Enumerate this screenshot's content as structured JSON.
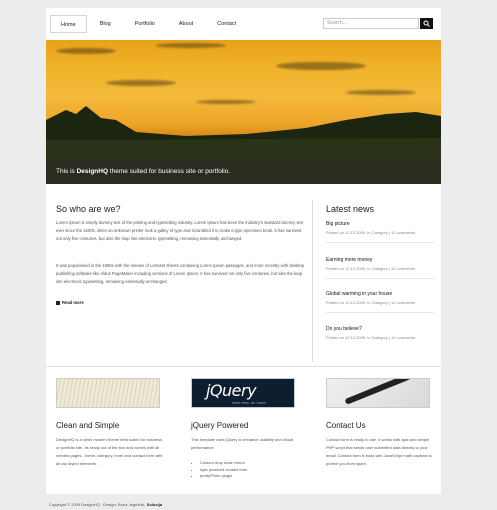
{
  "nav": {
    "items": [
      "Home",
      "Blog",
      "Portfolio",
      "About",
      "Contact"
    ],
    "active_index": 0,
    "search_placeholder": "Search..."
  },
  "hero": {
    "caption_prefix": "This is ",
    "caption_brand": "DesignHQ",
    "caption_suffix": " theme suited for business site or portfolio."
  },
  "main": {
    "title": "So who are we?",
    "paragraphs": [
      "Lorem Ipsum is simply dummy text of the printing and typesetting industry. Lorem Ipsum has been the industry's standard dummy text ever since the 1500s, when an unknown printer took a galley of type and scrambled it to make a type specimen book. It has survived not only five centuries, but also the leap into electronic typesetting, remaining essentially unchanged.",
      "It was popularised in the 1960s with the release of Letraset sheets containing Lorem Ipsum passages, and more recently with desktop publishing software like Aldus PageMaker including versions of Lorem Ipsum. It has survived not only five centuries, but also the leap into electronic typesetting, remaining essentially unchanged."
    ],
    "read_more": "Read more"
  },
  "sidebar": {
    "title": "Latest news",
    "items": [
      {
        "title": "Big picture",
        "meta": "Posted on 12.12.2009. in Category | 12 comments"
      },
      {
        "title": "Earning more money",
        "meta": "Posted on 12.12.2009. in Category | 12 comments"
      },
      {
        "title": "Global warming in your house",
        "meta": "Posted on 12.12.2009. in Category | 12 comments"
      },
      {
        "title": "Do you believe?",
        "meta": "Posted on 12.12.2009. in Category | 12 comments"
      }
    ]
  },
  "features": [
    {
      "title": "Clean and Simple",
      "text": "DesignHQ is a sleek modern theme best suited for business or portfolio site. Its ready out of the box and comes with all needed pages - home, category, inner and contact form with all css styled elements."
    },
    {
      "title": "jQuery Powered",
      "text": "This template uses jQuery to enhance usability and visual performance:",
      "list": [
        "Custom drop down menu",
        "Ajax powered contact form",
        "prettyPhoto plugin"
      ],
      "image_text": "jQuery",
      "image_tagline": "write less, do more"
    },
    {
      "title": "Contact Us",
      "text": "Contact form is ready to use. It works with ajax and simple PHP script that sends user submitted data directly to your email. Contact form is build with JavaScript math captcha to protect you from spam."
    }
  ],
  "footer": {
    "text": "Copyright © 2009 DesignHQ · Design: Borut Jegrišnik, ",
    "link": "Solucija"
  },
  "colors": {
    "accent_dark": "#111111",
    "background": "#ececec",
    "page": "#ffffff"
  }
}
